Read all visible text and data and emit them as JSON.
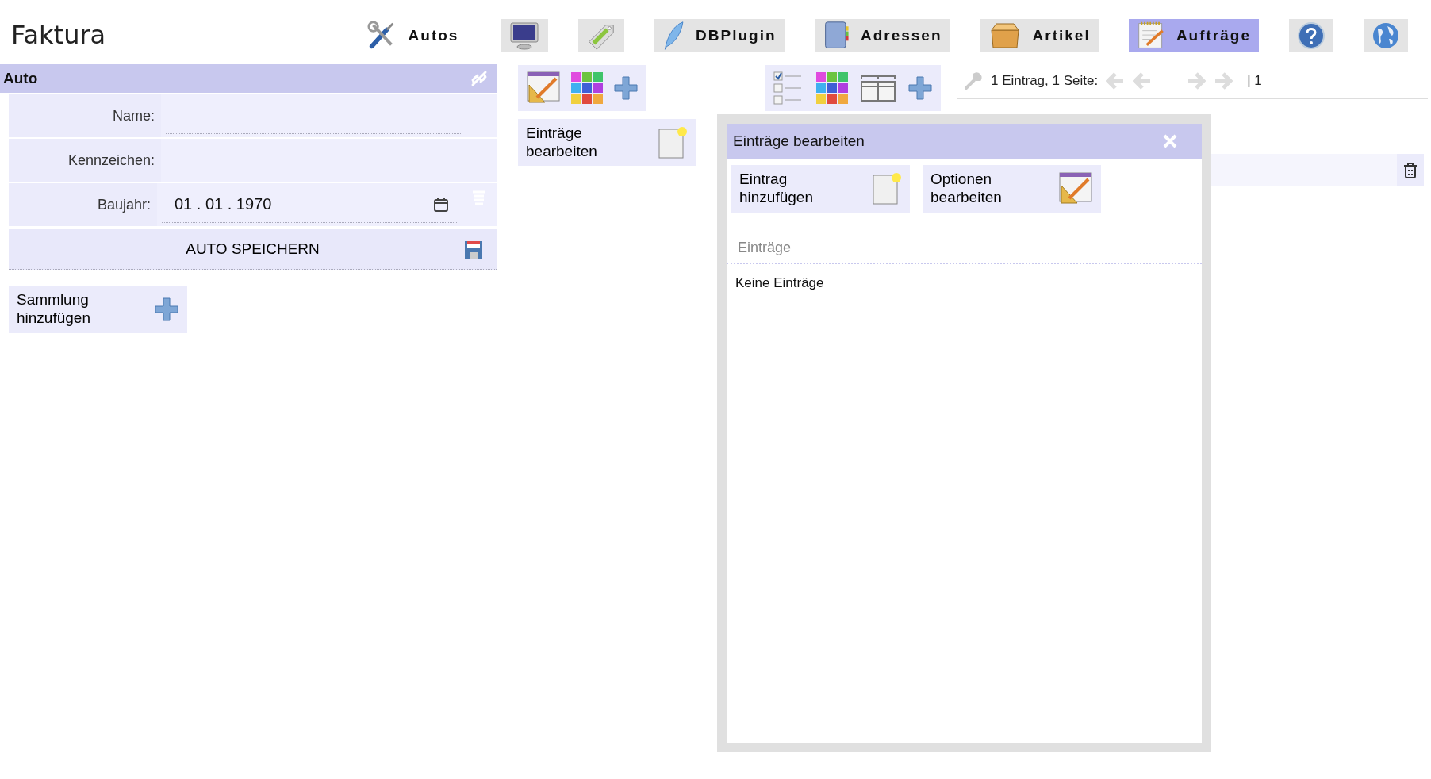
{
  "app_title": "Faktura",
  "nav": [
    {
      "kind": "tools",
      "label": "Autos",
      "selected": false
    },
    {
      "kind": "monitor",
      "selected": false
    },
    {
      "kind": "tag",
      "selected": false
    },
    {
      "kind": "feather",
      "label": "DBPlugin",
      "selected": false
    },
    {
      "kind": "book",
      "label": "Adressen",
      "selected": false
    },
    {
      "kind": "box",
      "label": "Artikel",
      "selected": false
    },
    {
      "kind": "notepad",
      "label": "Aufträge",
      "selected": true
    },
    {
      "kind": "help",
      "selected": false
    },
    {
      "kind": "globe",
      "selected": false
    }
  ],
  "panel": {
    "title": "Auto",
    "fields": [
      {
        "label": "Name:"
      },
      {
        "label": "Kennzeichen:"
      },
      {
        "label": "Baujahr:",
        "value": "01 . 01 . 1970",
        "kind": "date"
      }
    ],
    "save_button": "AUTO SPEICHERN",
    "add_collection_button": "Sammlung hinzufügen"
  },
  "edit_entries_button": "Einträge bearbeiten",
  "pager": {
    "summary": "1 Eintrag, 1 Seite:",
    "page": "| 1"
  },
  "dialog": {
    "title": "Einträge bearbeiten",
    "buttons": [
      {
        "kind": "new",
        "label": "Eintrag hinzufügen"
      },
      {
        "kind": "options",
        "label": "Optionen bearbeiten"
      }
    ],
    "section": "Einträge",
    "empty_text": "Keine Einträge"
  }
}
